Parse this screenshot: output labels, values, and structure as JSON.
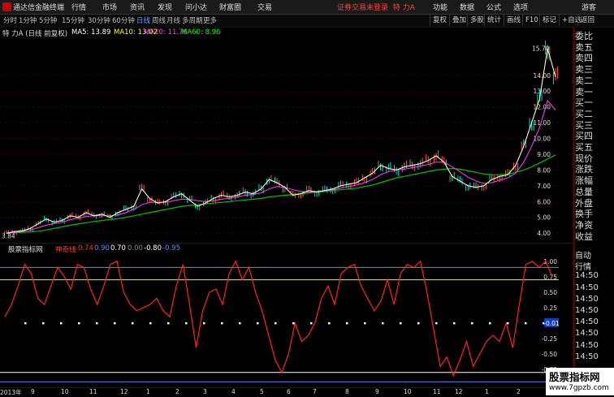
{
  "app": {
    "name": "通达信金融终端",
    "menus": [
      "行情",
      "市场",
      "资讯",
      "发现",
      "问小达",
      "财富圈",
      "交易"
    ],
    "status": "证券交易未登录",
    "stock_title": "特 力A",
    "right_menus": [
      "功能",
      "数据",
      "公式",
      "选项"
    ],
    "guest": "游客"
  },
  "toolbar": {
    "periods": [
      "分时",
      "1分钟",
      "5分钟",
      "15分钟",
      "30分钟",
      "60分钟",
      "日线",
      "周线",
      "月线",
      "多周期",
      "更多"
    ],
    "active_period": "日线",
    "right_buttons": [
      "复权",
      "叠加",
      "多股",
      "统计",
      "画线",
      "F10",
      "标记",
      "+自选",
      "返回"
    ]
  },
  "main": {
    "stock_label": "特 力A (日线 前复权)",
    "ma": [
      {
        "label": "MA5: 13.89",
        "color": "#ffffff"
      },
      {
        "label": "MA10: 13.02",
        "color": "#ffff00"
      },
      {
        "label": "MA20: 11.76",
        "color": "#ff40ff"
      },
      {
        "label": "MA60: 8.96",
        "color": "#00ff00"
      }
    ],
    "price_axis": [
      "14.00",
      "13.00",
      "12.00",
      "11.00",
      "10.00",
      "9.00",
      "8.00",
      "7.00",
      "6.00",
      "5.00",
      "4.00"
    ],
    "high_label": "15.70",
    "low_label": "3.84",
    "price_series": [
      4.0,
      4.1,
      4.15,
      4.3,
      4.6,
      4.9,
      4.7,
      4.8,
      5.1,
      5.0,
      5.3,
      5.1,
      5.2,
      5.0,
      5.3,
      5.5,
      5.7,
      6.8,
      6.2,
      5.9,
      6.0,
      6.3,
      6.5,
      6.1,
      5.7,
      5.9,
      6.2,
      6.4,
      6.3,
      6.4,
      6.6,
      6.5,
      6.8,
      7.4,
      7.2,
      6.9,
      6.4,
      6.5,
      6.7,
      6.6,
      6.7,
      6.8,
      7.0,
      7.1,
      7.2,
      7.5,
      7.8,
      8.3,
      8.1,
      8.0,
      8.2,
      8.3,
      8.4,
      8.6,
      8.9,
      8.5,
      7.6,
      7.3,
      7.0,
      6.9,
      7.0,
      7.4,
      7.6,
      7.7,
      8.3,
      9.5,
      11.0,
      12.5,
      15.7,
      13.9
    ],
    "ma20_series": [
      4.0,
      4.05,
      4.1,
      4.2,
      4.35,
      4.5,
      4.6,
      4.7,
      4.85,
      4.95,
      5.05,
      5.1,
      5.1,
      5.1,
      5.15,
      5.3,
      5.5,
      5.8,
      5.95,
      5.95,
      5.95,
      6.05,
      6.15,
      6.15,
      6.05,
      6.0,
      6.05,
      6.15,
      6.2,
      6.3,
      6.4,
      6.45,
      6.55,
      6.8,
      6.95,
      6.9,
      6.75,
      6.65,
      6.6,
      6.65,
      6.7,
      6.75,
      6.85,
      6.95,
      7.05,
      7.2,
      7.4,
      7.7,
      7.9,
      8.0,
      8.05,
      8.15,
      8.25,
      8.35,
      8.5,
      8.5,
      8.2,
      7.9,
      7.55,
      7.3,
      7.15,
      7.2,
      7.35,
      7.5,
      7.8,
      8.5,
      9.5,
      10.7,
      12.4,
      11.8
    ],
    "ma60_series": [
      4.0,
      4.02,
      4.05,
      4.08,
      4.12,
      4.2,
      4.3,
      4.4,
      4.5,
      4.58,
      4.66,
      4.74,
      4.8,
      4.86,
      4.92,
      5.0,
      5.1,
      5.2,
      5.3,
      5.4,
      5.5,
      5.6,
      5.7,
      5.75,
      5.8,
      5.85,
      5.9,
      5.95,
      6.0,
      6.05,
      6.1,
      6.15,
      6.2,
      6.3,
      6.35,
      6.4,
      6.45,
      6.5,
      6.55,
      6.6,
      6.65,
      6.7,
      6.75,
      6.8,
      6.85,
      6.95,
      7.05,
      7.2,
      7.35,
      7.5,
      7.6,
      7.7,
      7.8,
      7.9,
      8.0,
      8.05,
      8.1,
      8.05,
      7.95,
      7.85,
      7.75,
      7.7,
      7.7,
      7.75,
      7.85,
      8.0,
      8.2,
      8.45,
      8.7,
      8.96
    ]
  },
  "sub": {
    "title": "股票指标网",
    "indicator": "神奇线",
    "values": [
      {
        "label": "0.74",
        "color": "#ff3030"
      },
      {
        "label": "0.90",
        "color": "#5a8cff"
      },
      {
        "label": "0.70",
        "color": "#ffffff"
      },
      {
        "label": "0.00",
        "color": "#888888"
      },
      {
        "label": "-0.80",
        "color": "#ffffff"
      },
      {
        "label": "-0.95",
        "color": "#5a8cff"
      }
    ],
    "axis": [
      "1.00",
      "0.75",
      "0.50",
      "0.25",
      "0.00",
      "-0.25",
      "-0.50",
      "-0.75"
    ],
    "current_tag": "-0.01",
    "osc_series": [
      0.1,
      0.3,
      0.6,
      0.95,
      0.8,
      0.4,
      0.3,
      0.6,
      0.9,
      0.75,
      0.55,
      0.95,
      0.9,
      0.55,
      0.3,
      0.6,
      0.95,
      1.0,
      0.5,
      0.3,
      0.2,
      0.25,
      0.3,
      0.4,
      0.2,
      0.1,
      0.6,
      0.95,
      0.3,
      -0.4,
      0.2,
      0.5,
      0.55,
      0.3,
      0.8,
      1.0,
      0.7,
      0.9,
      0.5,
      0.2,
      -0.2,
      -0.6,
      -0.8,
      -0.5,
      0.0,
      -0.3,
      -0.2,
      0.0,
      0.4,
      0.6,
      0.3,
      0.8,
      0.9,
      0.95,
      0.6,
      0.4,
      0.2,
      0.35,
      0.7,
      0.3,
      0.8,
      0.95,
      0.9,
      1.0,
      0.5,
      -0.1,
      -0.7,
      -0.55,
      -0.85,
      -0.6,
      -0.3,
      -0.7,
      -0.5,
      -0.3,
      -0.2,
      -0.3,
      0.0,
      -0.4,
      0.3,
      0.95,
      1.0,
      0.9,
      1.0,
      0.75
    ]
  },
  "right_panel": [
    "委比",
    "卖五",
    "卖四",
    "卖三",
    "卖二",
    "卖一",
    "买一",
    "买二",
    "买三",
    "买四",
    "买五",
    "现价",
    "涨跌",
    "涨幅",
    "总量",
    "外盘",
    "换手",
    "净资",
    "收益"
  ],
  "right_panel2": [
    "自动",
    "行情",
    "14:50",
    "14:50",
    "14:50",
    "14:50",
    "14:50",
    "14:50",
    "14:50",
    "14:50"
  ],
  "months": [
    "2013年",
    "9",
    "10",
    "11",
    "12",
    "1",
    "2",
    "3",
    "4",
    "5",
    "6",
    "7",
    "8",
    "9",
    "10",
    "11",
    "12",
    "1",
    "2"
  ],
  "watermark": {
    "line1": "股票指标网",
    "line2": "www.7gpzb.com"
  }
}
